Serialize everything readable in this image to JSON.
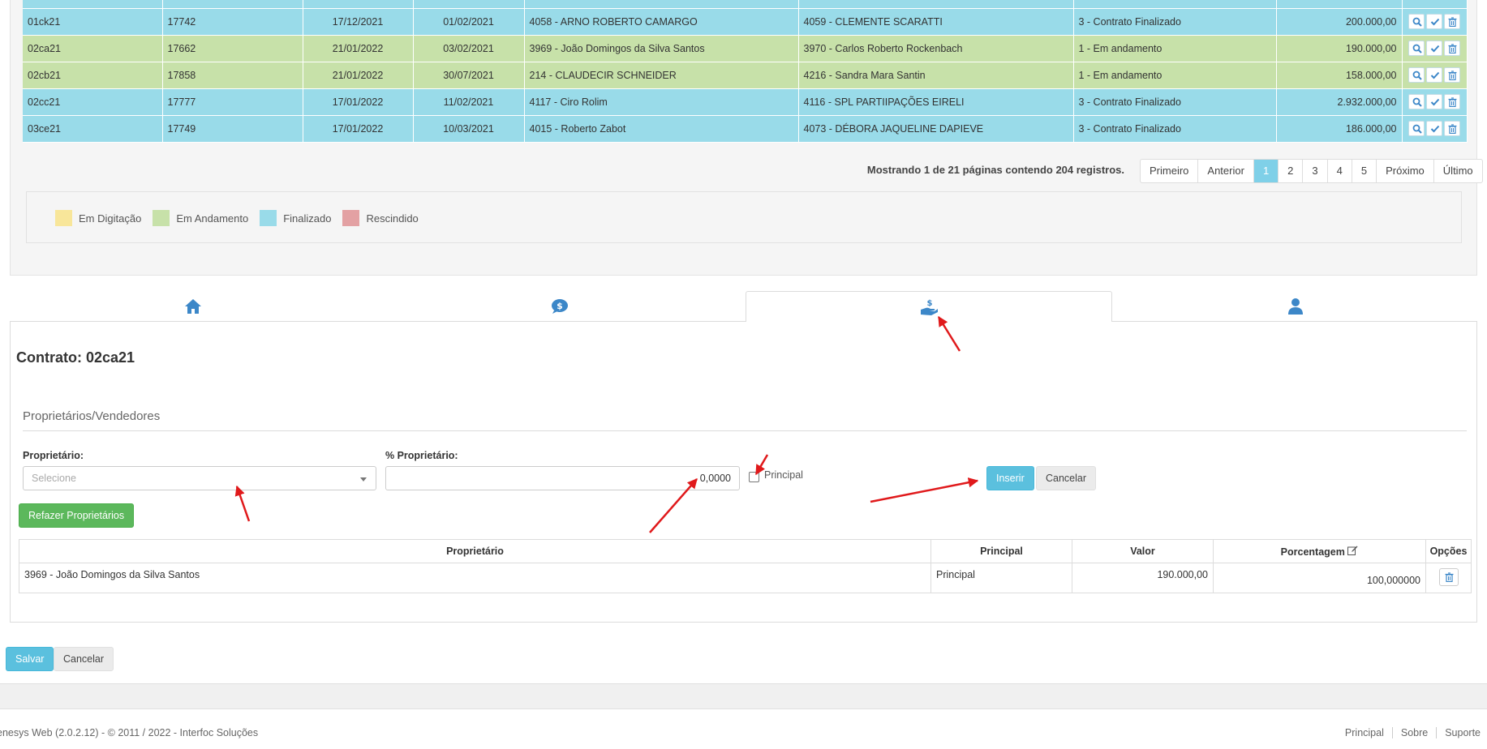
{
  "grid": {
    "rows": [
      {
        "code": "01ck21",
        "num": "17742",
        "date1": "17/12/2021",
        "date2": "01/02/2021",
        "owner": "4058 - ARNO ROBERTO CAMARGO",
        "buyer": "4059 - CLEMENTE SCARATTI",
        "status": "3 - Contrato Finalizado",
        "value": "200.000,00",
        "kind": "fin"
      },
      {
        "code": "02ca21",
        "num": "17662",
        "date1": "21/01/2022",
        "date2": "03/02/2021",
        "owner": "3969 - João Domingos da Silva Santos",
        "buyer": "3970 - Carlos Roberto Rockenbach",
        "status": "1 - Em andamento",
        "value": "190.000,00",
        "kind": "and"
      },
      {
        "code": "02cb21",
        "num": "17858",
        "date1": "21/01/2022",
        "date2": "30/07/2021",
        "owner": "214 - CLAUDECIR SCHNEIDER",
        "buyer": "4216 - Sandra Mara Santin",
        "status": "1 - Em andamento",
        "value": "158.000,00",
        "kind": "and"
      },
      {
        "code": "02cc21",
        "num": "17777",
        "date1": "17/01/2022",
        "date2": "11/02/2021",
        "owner": "4117 - Ciro Rolim",
        "buyer": "4116 - SPL PARTIIPAÇÕES EIRELI",
        "status": "3 - Contrato Finalizado",
        "value": "2.932.000,00",
        "kind": "fin"
      },
      {
        "code": "03ce21",
        "num": "17749",
        "date1": "17/01/2022",
        "date2": "10/03/2021",
        "owner": "4015 - Roberto Zabot",
        "buyer": "4073 - DÉBORA JAQUELINE DAPIEVE",
        "status": "3 - Contrato Finalizado",
        "value": "186.000,00",
        "kind": "fin"
      }
    ]
  },
  "pager": {
    "summary": "Mostrando 1 de 21 páginas contendo 204 registros.",
    "first": "Primeiro",
    "prev": "Anterior",
    "pages": [
      "1",
      "2",
      "3",
      "4",
      "5"
    ],
    "next": "Próximo",
    "last": "Último"
  },
  "legend": {
    "items": [
      {
        "label": "Em Digitação",
        "color": "#f8e69a"
      },
      {
        "label": "Em Andamento",
        "color": "#c7e1a9"
      },
      {
        "label": "Finalizado",
        "color": "#99dbe9"
      },
      {
        "label": "Rescindido",
        "color": "#e3a1a3"
      }
    ]
  },
  "tabs": [
    {
      "icon": "home-icon"
    },
    {
      "icon": "money-chat-icon"
    },
    {
      "icon": "hand-money-icon",
      "active": true
    },
    {
      "icon": "user-icon"
    }
  ],
  "form": {
    "contract_title": "Contrato: 02ca21",
    "section_title": "Proprietários/Vendedores",
    "owner_label": "Proprietário:",
    "owner_placeholder": "Selecione",
    "pct_label": "% Proprietário:",
    "pct_value": "0,0000",
    "principal_label": "Principal",
    "insert_button": "Inserir",
    "cancel_button": "Cancelar",
    "redo_button": "Refazer Proprietários"
  },
  "owners_table": {
    "headers": {
      "owner": "Proprietário",
      "principal": "Principal",
      "value": "Valor",
      "percent": "Porcentagem",
      "options": "Opções"
    },
    "rows": [
      {
        "owner": "3969 - João Domingos da Silva Santos",
        "principal": "Principal",
        "value": "190.000,00",
        "percent": "100,000000"
      }
    ]
  },
  "actions": {
    "save": "Salvar",
    "cancel": "Cancelar"
  },
  "footer": {
    "copyright": "enesys Web (2.0.2.12) - © 2011 / 2022 - Interfoc Soluções",
    "links": [
      "Principal",
      "Sobre",
      "Suporte"
    ]
  },
  "colors": {
    "accent": "#5bc0de",
    "success": "#5cb85c",
    "icon_blue": "#3c87c8",
    "annotation_red": "#e0191b"
  }
}
